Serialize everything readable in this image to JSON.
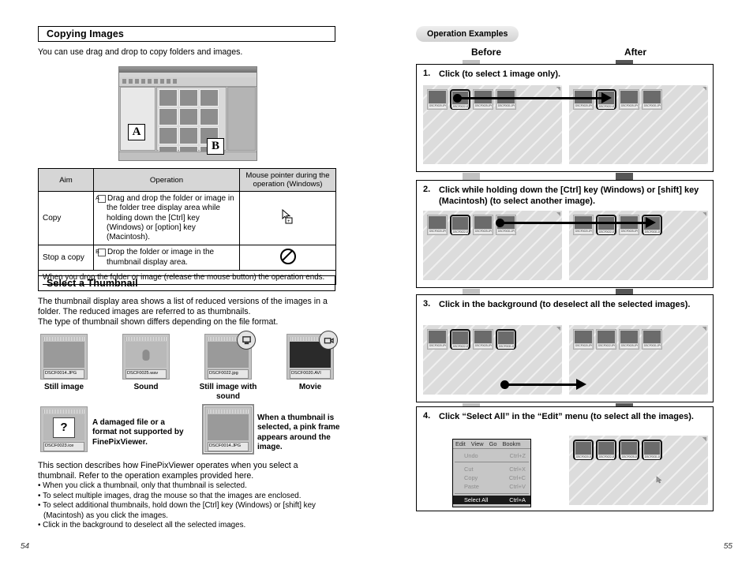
{
  "left_page": {
    "page_number": "54",
    "section1": {
      "heading": "Copying Images",
      "intro": "You can use drag and drop to copy folders and images.",
      "screenshot_labels": {
        "a": "A",
        "b": "B"
      },
      "table": {
        "headers": [
          "Aim",
          "Operation",
          "Mouse pointer during the operation (Windows)"
        ],
        "rows": [
          {
            "aim": "Copy",
            "marker": "A",
            "operation": "Drag and drop the folder or image in the folder tree display area while holding down the [Ctrl] key (Windows) or [option] key (Macintosh).",
            "pointer_icon": "copy-cursor-icon"
          },
          {
            "aim": "Stop a copy",
            "marker": "B",
            "operation": "Drop the folder or image in the thumbnail display area.",
            "pointer_icon": "no-entry-icon"
          }
        ],
        "footer_note": "When you drop the folder or image (release the mouse button) the operation ends."
      }
    },
    "section2": {
      "heading": "Select a Thumbnail",
      "intro_line1": "The thumbnail display area shows a list of reduced versions of the images in a",
      "intro_line2": "folder. The reduced images are referred to as thumbnails.",
      "intro_line3": "The type of thumbnail shown differs depending on the file format.",
      "thumbnails": [
        {
          "filename": "DSCF0014.JPG",
          "caption": "Still image",
          "badge": ""
        },
        {
          "filename": "DSCF0025.wav",
          "caption": "Sound",
          "badge": ""
        },
        {
          "filename": "DSCF0022.jpg",
          "caption": "Still image with sound",
          "badge": "sound-badge-icon"
        },
        {
          "filename": "DSCF0020.AVI",
          "caption": "Movie",
          "badge": "movie-badge-icon"
        }
      ],
      "damaged": {
        "filename": "DSCF0023.ice",
        "glyph": "?",
        "caption": "A damaged file or a format not supported by FinePixViewer."
      },
      "selected": {
        "filename": "DSCF0014.JPG",
        "caption": "When a thumbnail is selected, a pink frame appears around the image."
      },
      "closing": {
        "line1": "This section describes how FinePixViewer operates when you select a",
        "line2": "thumbnail. Refer to the operation examples provided here.",
        "bullets": [
          "When you click a thumbnail, only that thumbnail is selected.",
          "To select multiple images, drag the mouse so that the images are enclosed.",
          "To select additional thumbnails, hold down the [Ctrl] key (Windows) or [shift] key (Macintosh) as you click the images.",
          "Click in the background to deselect all the selected images."
        ]
      }
    }
  },
  "right_page": {
    "page_number": "55",
    "pill_label": "Operation Examples",
    "before_label": "Before",
    "after_label": "After",
    "steps": [
      {
        "number": "1.",
        "text": "Click (to select 1 image only).",
        "before": {
          "thumbs": [
            {
              "filename": "DSCF0020.JPG",
              "selected": false
            },
            {
              "filename": "DSCF0022.JPG",
              "selected": true
            },
            {
              "filename": "DSCF0025.JPG",
              "selected": false
            },
            {
              "filename": "DSCF0031.JPG",
              "selected": false
            }
          ]
        },
        "after": {
          "thumbs": [
            {
              "filename": "DSCF0020.JPG",
              "selected": false
            },
            {
              "filename": "DSCF0022.JPG",
              "selected": true
            },
            {
              "filename": "DSCF0025.JPG",
              "selected": false
            },
            {
              "filename": "DSCF0031.JPG",
              "selected": false
            }
          ]
        }
      },
      {
        "number": "2.",
        "text": "Click while holding down the [Ctrl] key (Windows) or [shift] key (Macintosh) (to select another image).",
        "before": {
          "thumbs": [
            {
              "filename": "DSCF0020.JPG",
              "selected": false
            },
            {
              "filename": "DSCF0022.JPG",
              "selected": true
            },
            {
              "filename": "DSCF0025.JPG",
              "selected": false
            },
            {
              "filename": "DSCF0031.JPG",
              "selected": false
            }
          ]
        },
        "after": {
          "thumbs": [
            {
              "filename": "DSCF0020.JPG",
              "selected": false
            },
            {
              "filename": "DSCF0022.JPG",
              "selected": true
            },
            {
              "filename": "DSCF0025.JPG",
              "selected": false
            },
            {
              "filename": "DSCF0031.JPG",
              "selected": true
            }
          ]
        }
      },
      {
        "number": "3.",
        "text": "Click in the background (to deselect all the selected images).",
        "before": {
          "thumbs": [
            {
              "filename": "DSCF0020.JPG",
              "selected": false
            },
            {
              "filename": "DSCF0022.JPG",
              "selected": true
            },
            {
              "filename": "DSCF0025.JPG",
              "selected": false
            },
            {
              "filename": "DSCF0031.JPG",
              "selected": true
            }
          ]
        },
        "after": {
          "thumbs": [
            {
              "filename": "DSCF0020.JPG",
              "selected": false
            },
            {
              "filename": "DSCF0022.JPG",
              "selected": false
            },
            {
              "filename": "DSCF0025.JPG",
              "selected": false
            },
            {
              "filename": "DSCF0031.JPG",
              "selected": false
            }
          ]
        }
      },
      {
        "number": "4.",
        "text": "Click “Select All” in the “Edit” menu (to select all the images).",
        "menu": {
          "menubar": [
            "Edit",
            "View",
            "Go",
            "Bookm"
          ],
          "items": [
            {
              "label": "Undo",
              "shortcut": "Ctrl+Z",
              "highlighted": false
            },
            {
              "label": "Cut",
              "shortcut": "Ctrl+X",
              "highlighted": false
            },
            {
              "label": "Copy",
              "shortcut": "Ctrl+C",
              "highlighted": false
            },
            {
              "label": "Paste",
              "shortcut": "Ctrl+V",
              "highlighted": false
            },
            {
              "label": "Select All",
              "shortcut": "Ctrl+A",
              "highlighted": true
            }
          ]
        },
        "after": {
          "thumbs": [
            {
              "filename": "DSCF0020.JPG",
              "selected": true
            },
            {
              "filename": "DSCF0022.JPG",
              "selected": true
            },
            {
              "filename": "DSCF0025.JPG",
              "selected": true
            },
            {
              "filename": "DSCF0031.JPG",
              "selected": true
            }
          ]
        }
      }
    ]
  }
}
